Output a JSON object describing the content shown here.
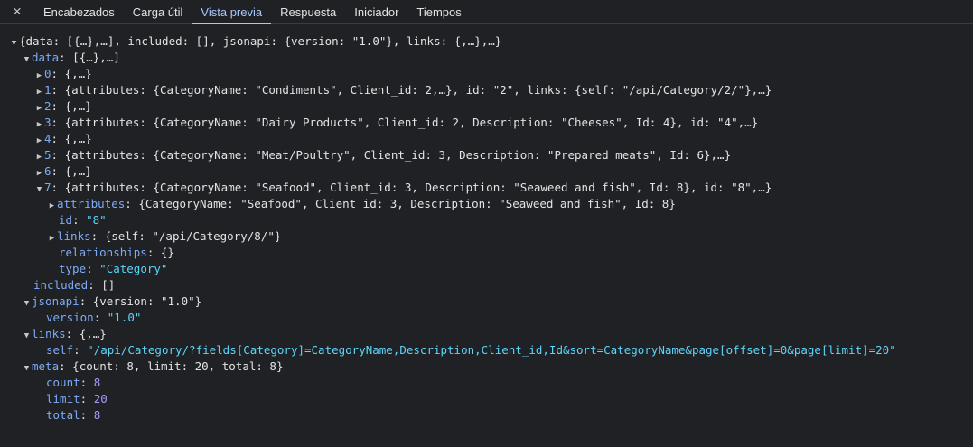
{
  "tabs": {
    "close_icon": "×",
    "items": [
      "Encabezados",
      "Carga útil",
      "Vista previa",
      "Respuesta",
      "Iniciador",
      "Tiempos"
    ],
    "active": "Vista previa"
  },
  "tree": {
    "root_summary": "{data: [{…},…], included: [], jsonapi: {version: \"1.0\"}, links: {,…},…}",
    "data": {
      "key": "data",
      "summary": "[{…},…]",
      "items": [
        {
          "index": "0",
          "summary": "{,…}"
        },
        {
          "index": "1",
          "summary": "{attributes: {CategoryName: \"Condiments\", Client_id: 2,…}, id: \"2\", links: {self: \"/api/Category/2/\"},…}"
        },
        {
          "index": "2",
          "summary": "{,…}"
        },
        {
          "index": "3",
          "summary": "{attributes: {CategoryName: \"Dairy Products\", Client_id: 2, Description: \"Cheeses\", Id: 4}, id: \"4\",…}"
        },
        {
          "index": "4",
          "summary": "{,…}"
        },
        {
          "index": "5",
          "summary": "{attributes: {CategoryName: \"Meat/Poultry\", Client_id: 3, Description: \"Prepared meats\", Id: 6},…}"
        },
        {
          "index": "6",
          "summary": "{,…}"
        },
        {
          "index": "7",
          "summary": "{attributes: {CategoryName: \"Seafood\", Client_id: 3, Description: \"Seaweed and fish\", Id: 8}, id: \"8\",…}"
        }
      ],
      "item7": {
        "attributes_key": "attributes",
        "attributes_summary": "{CategoryName: \"Seafood\", Client_id: 3, Description: \"Seaweed and fish\", Id: 8}",
        "id_key": "id",
        "id_value": "\"8\"",
        "links_key": "links",
        "links_summary": "{self: \"/api/Category/8/\"}",
        "relationships_key": "relationships",
        "relationships_value": "{}",
        "type_key": "type",
        "type_value": "\"Category\""
      }
    },
    "included": {
      "key": "included",
      "value": "[]"
    },
    "jsonapi": {
      "key": "jsonapi",
      "summary": "{version: \"1.0\"}",
      "version_key": "version",
      "version_value": "\"1.0\""
    },
    "links": {
      "key": "links",
      "summary": "{,…}",
      "self_key": "self",
      "self_value": "\"/api/Category/?fields[Category]=CategoryName,Description,Client_id,Id&sort=CategoryName&page[offset]=0&page[limit]=20\""
    },
    "meta": {
      "key": "meta",
      "summary": "{count: 8, limit: 20, total: 8}",
      "count_key": "count",
      "count_value": "8",
      "limit_key": "limit",
      "limit_value": "20",
      "total_key": "total",
      "total_value": "8"
    }
  }
}
